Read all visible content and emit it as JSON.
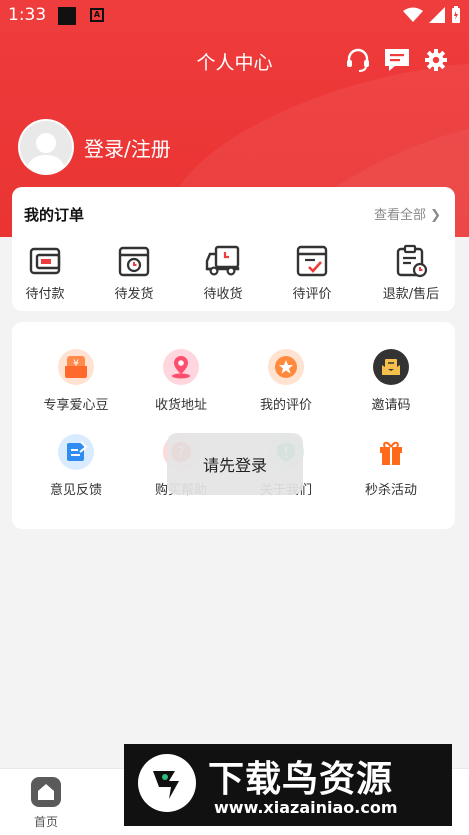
{
  "status_bar": {
    "time": "1:33"
  },
  "header": {
    "title": "个人中心"
  },
  "profile": {
    "login_label": "登录/注册"
  },
  "orders": {
    "title": "我的订单",
    "view_all": "查看全部 ❯",
    "items": [
      {
        "label": "待付款",
        "icon": "wallet-icon"
      },
      {
        "label": "待发货",
        "icon": "package-clock-icon"
      },
      {
        "label": "待收货",
        "icon": "truck-icon"
      },
      {
        "label": "待评价",
        "icon": "review-check-icon"
      },
      {
        "label": "退款/售后",
        "icon": "refund-icon"
      }
    ]
  },
  "services": {
    "items": [
      {
        "label": "专享爱心豆",
        "icon": "love-bean-icon",
        "color": "#ff8a4c"
      },
      {
        "label": "收货地址",
        "icon": "location-pin-icon",
        "color": "#ff4d6d"
      },
      {
        "label": "我的评价",
        "icon": "star-badge-icon",
        "color": "#ff8a3d"
      },
      {
        "label": "邀请码",
        "icon": "envelope-icon",
        "color": "#333333"
      },
      {
        "label": "意见反馈",
        "icon": "feedback-edit-icon",
        "color": "#2f8cf0"
      },
      {
        "label": "购买帮助",
        "icon": "help-icon",
        "color": "#ff5a5a"
      },
      {
        "label": "关于我们",
        "icon": "info-shield-icon",
        "color": "#2dbf7a"
      },
      {
        "label": "秒杀活动",
        "icon": "gift-icon",
        "color": "#ff6a1a"
      }
    ]
  },
  "toast": {
    "message": "请先登录"
  },
  "bottom_nav": {
    "items": [
      {
        "label": "首页",
        "icon": "home-icon"
      }
    ]
  },
  "watermark": {
    "brand": "下载鸟资源",
    "url": "www.xiazainiao.com"
  },
  "colors": {
    "accent": "#ef3c3c"
  }
}
